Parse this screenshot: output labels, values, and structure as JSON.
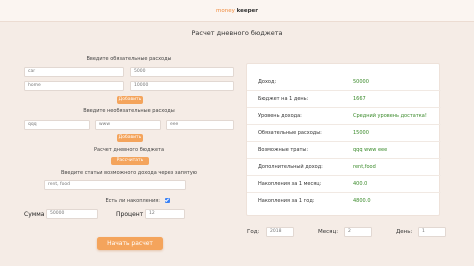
{
  "header": {
    "brand_prefix": "money",
    "brand_suffix": "keeper"
  },
  "page_title": "Расчет дневного бюджета",
  "required_expenses": {
    "label": "Введите обязательные расходы",
    "rows": [
      {
        "name": "car",
        "amount": "5000"
      },
      {
        "name": "home",
        "amount": "10000"
      }
    ],
    "add_label": "Добавить"
  },
  "optional_expenses": {
    "label": "Введите необязательные расходы",
    "items": [
      "qqq",
      "www",
      "eee"
    ],
    "add_label": "Добавить"
  },
  "daily_budget": {
    "label": "Расчет дневного бюджета",
    "button_label": "Рассчитать"
  },
  "income": {
    "label": "Введите статьи возможного дохода через запятую",
    "value": "rent, food"
  },
  "savings": {
    "label": "Есть ли накопления:",
    "checked": true,
    "sum_label": "Сумма",
    "sum_value": "50000",
    "percent_label": "Процент",
    "percent_value": "12"
  },
  "start_button": "Начать расчет",
  "results": [
    {
      "key": "Доход:",
      "value": "50000"
    },
    {
      "key": "Бюджет на 1 день:",
      "value": "1667"
    },
    {
      "key": "Уровень дохода:",
      "value": "Средний уровень достатка!"
    },
    {
      "key": "Обязательные расходы:",
      "value": "15000"
    },
    {
      "key": "Возможные траты:",
      "value": "qqq www eee"
    },
    {
      "key": "Дополнительный доход:",
      "value": "rent,food"
    },
    {
      "key": "Накопления за 1 месяц:",
      "value": "400.0"
    },
    {
      "key": "Накопления за 1 год:",
      "value": "4800.0"
    }
  ],
  "date": {
    "year_label": "Год:",
    "year_value": "2018",
    "month_label": "Месяц:",
    "month_value": "2",
    "day_label": "День:",
    "day_value": "1"
  }
}
